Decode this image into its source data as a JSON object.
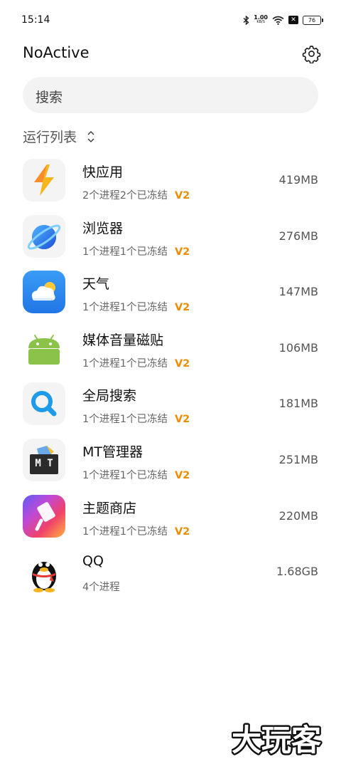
{
  "status": {
    "time": "15:14",
    "speed_value": "1.00",
    "speed_unit": "KB/S",
    "battery": "76"
  },
  "header": {
    "title": "NoActive"
  },
  "search": {
    "placeholder": "搜索"
  },
  "section": {
    "label": "运行列表"
  },
  "apps": [
    {
      "name": "快应用",
      "sub": "2个进程2个已冻结",
      "tag": "V2",
      "mem": "419MB",
      "icon": "lightning-icon"
    },
    {
      "name": "浏览器",
      "sub": "1个进程1个已冻结",
      "tag": "V2",
      "mem": "276MB",
      "icon": "planet-icon"
    },
    {
      "name": "天气",
      "sub": "1个进程1个已冻结",
      "tag": "V2",
      "mem": "147MB",
      "icon": "cloud-sun-icon"
    },
    {
      "name": "媒体音量磁贴",
      "sub": "1个进程1个已冻结",
      "tag": "V2",
      "mem": "106MB",
      "icon": "android-icon"
    },
    {
      "name": "全局搜索",
      "sub": "1个进程1个已冻结",
      "tag": "V2",
      "mem": "181MB",
      "icon": "magnifier-icon"
    },
    {
      "name": "MT管理器",
      "sub": "1个进程1个已冻结",
      "tag": "V2",
      "mem": "251MB",
      "icon": "mt-icon",
      "icon_text": "M T"
    },
    {
      "name": "主题商店",
      "sub": "1个进程1个已冻结",
      "tag": "V2",
      "mem": "220MB",
      "icon": "paintbrush-icon"
    },
    {
      "name": "QQ",
      "sub": "4个进程",
      "tag": "",
      "mem": "1.68GB",
      "icon": "penguin-icon"
    }
  ],
  "watermark": {
    "text": "大玩客"
  }
}
